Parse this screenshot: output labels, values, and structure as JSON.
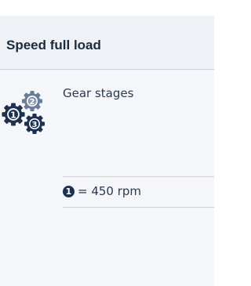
{
  "header": {
    "title": "Speed full load"
  },
  "gear_stages": {
    "label": "Gear stages",
    "icon": "gears-icon",
    "numbers": [
      "1",
      "2",
      "3"
    ]
  },
  "speed": {
    "stage_badge": "1",
    "value_text": "= 450 rpm"
  },
  "colors": {
    "header_bg": "#eef1f5",
    "panel_bg": "#f4f6fa",
    "navy": "#1c3150",
    "steel": "#6a7b95",
    "divider": "#c9d1db"
  }
}
